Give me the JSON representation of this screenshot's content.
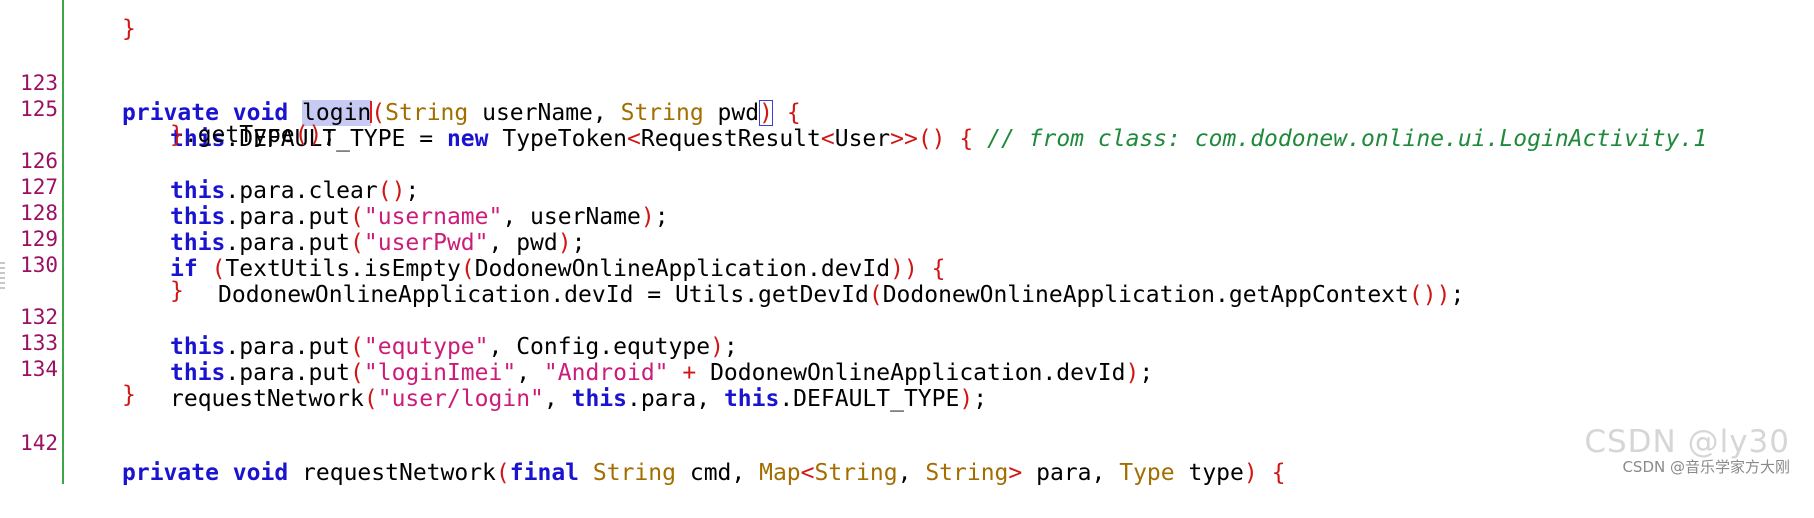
{
  "editor": {
    "top_partial": "}",
    "lines": [
      {
        "num": "123",
        "indent": 1
      },
      {
        "num": "125",
        "indent": 2
      },
      {
        "num": "",
        "indent": 2
      },
      {
        "num": "126",
        "indent": 2
      },
      {
        "num": "127",
        "indent": 2
      },
      {
        "num": "128",
        "indent": 2
      },
      {
        "num": "129",
        "indent": 2
      },
      {
        "num": "130",
        "indent": 3
      },
      {
        "num": "",
        "indent": 2
      },
      {
        "num": "132",
        "indent": 2
      },
      {
        "num": "133",
        "indent": 2
      },
      {
        "num": "134",
        "indent": 2
      },
      {
        "num": "",
        "indent": 1
      },
      {
        "num": "142",
        "indent": 1
      }
    ],
    "tokens": {
      "l123": [
        "private",
        "void",
        "login",
        "(",
        "String",
        "userName,",
        "String",
        "pwd",
        ")",
        "{"
      ],
      "l125": [
        "this",
        ".DEFAULT_TYPE = ",
        "new",
        "TypeToken",
        "<",
        "RequestResult",
        "<",
        "User",
        ">>",
        "()",
        "{",
        "// from class: com.dodonew.online.ui.LoginActivity.1"
      ],
      "l125b": [
        "}",
        ".getType",
        "()",
        ";"
      ],
      "l126": [
        "this",
        ".para.clear",
        "()",
        ";"
      ],
      "l127": [
        "this",
        ".para.put",
        "(",
        "\"username\"",
        ", userName",
        ")",
        ";"
      ],
      "l128": [
        "this",
        ".para.put",
        "(",
        "\"userPwd\"",
        ", pwd",
        ")",
        ";"
      ],
      "l129": [
        "if",
        "(",
        "TextUtils.isEmpty",
        "(",
        "DodonewOnlineApplication.devId",
        "))",
        "{"
      ],
      "l130": [
        "DodonewOnlineApplication.devId = Utils.getDevId",
        "(",
        "DodonewOnlineApplication.getAppContext",
        "())",
        ";"
      ],
      "l130b": [
        "}"
      ],
      "l132": [
        "this",
        ".para.put",
        "(",
        "\"equtype\"",
        ", Config.equtype",
        ")",
        ";"
      ],
      "l133": [
        "this",
        ".para.put",
        "(",
        "\"loginImei\"",
        ", ",
        "\"Android\"",
        " + ",
        "DodonewOnlineApplication.devId",
        ")",
        ";"
      ],
      "l134": [
        "requestNetwork",
        "(",
        "\"user/login\"",
        ", ",
        "this",
        ".para, ",
        "this",
        ".DEFAULT_TYPE",
        ")",
        ";"
      ],
      "l134b": [
        "}"
      ],
      "l142": [
        "private",
        "void",
        "requestNetwork",
        "(",
        "final",
        "String",
        "cmd,",
        "Map",
        "<",
        "String",
        ",",
        "String",
        ">",
        "para,",
        "Type",
        "type",
        ")",
        "{"
      ]
    }
  },
  "watermark": {
    "big": "CSDN @ly30",
    "small": "CSDN @音乐学家方大刚"
  }
}
